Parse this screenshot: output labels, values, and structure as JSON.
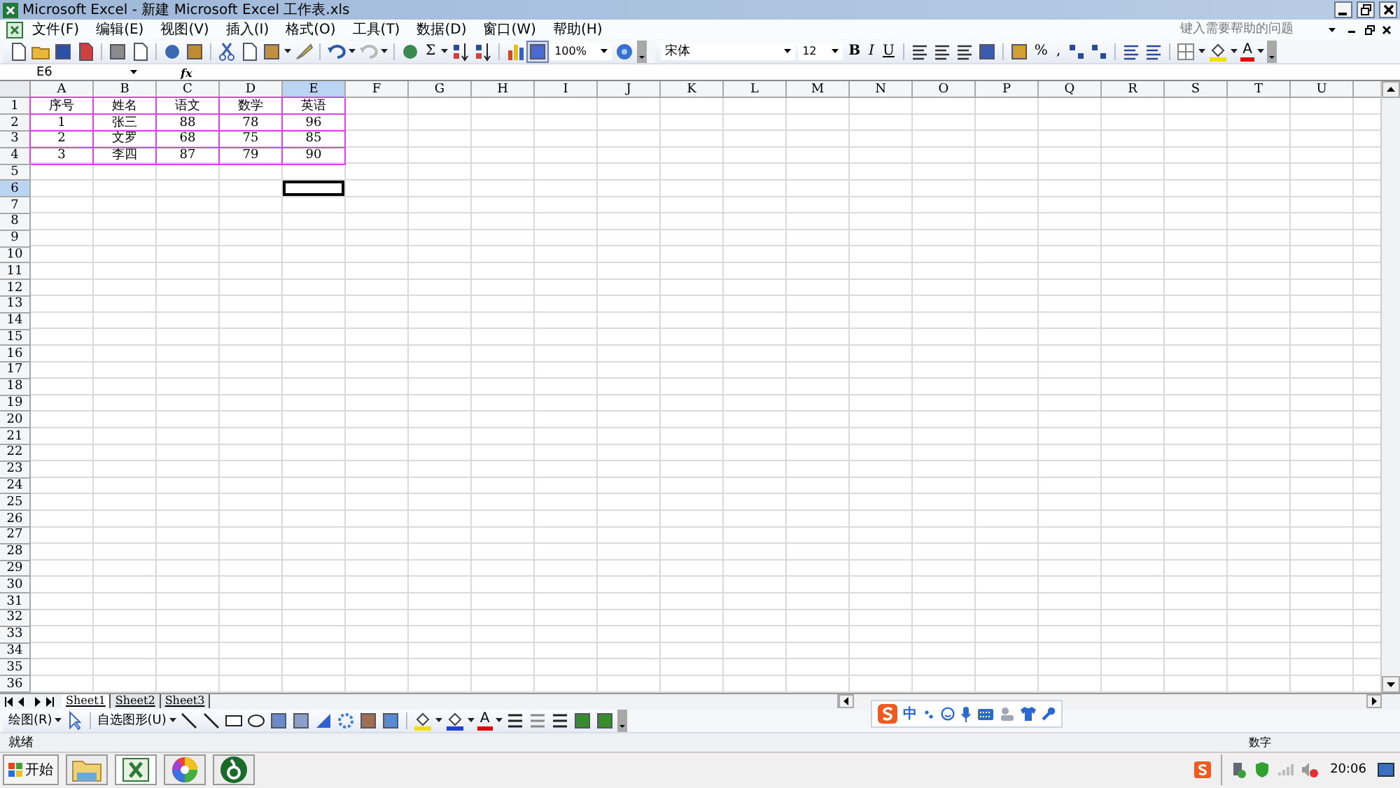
{
  "window": {
    "title": "Microsoft Excel - 新建 Microsoft Excel 工作表.xls"
  },
  "menu": [
    "文件(F)",
    "编辑(E)",
    "视图(V)",
    "插入(I)",
    "格式(O)",
    "工具(T)",
    "数据(D)",
    "窗口(W)",
    "帮助(H)"
  ],
  "help_search": {
    "placeholder": "键入需要帮助的问题"
  },
  "standard_toolbar": {
    "autosum": "Σ",
    "zoom": "100%"
  },
  "formatting_toolbar": {
    "font": "宋体",
    "size": "12",
    "bold": "B",
    "italic": "I",
    "underline": "U",
    "percent": "%",
    "comma": ",",
    "font_color": "A"
  },
  "formula_bar": {
    "name_box": "E6",
    "fx": "fx"
  },
  "sheet": {
    "columns": [
      {
        "label": "A",
        "selected": false
      },
      {
        "label": "B",
        "selected": false
      },
      {
        "label": "C",
        "selected": false
      },
      {
        "label": "D",
        "selected": false
      },
      {
        "label": "E",
        "selected": true
      },
      {
        "label": "F",
        "selected": false
      },
      {
        "label": "G",
        "selected": false
      },
      {
        "label": "H",
        "selected": false
      },
      {
        "label": "I",
        "selected": false
      },
      {
        "label": "J",
        "selected": false
      },
      {
        "label": "K",
        "selected": false
      },
      {
        "label": "L",
        "selected": false
      },
      {
        "label": "M",
        "selected": false
      },
      {
        "label": "N",
        "selected": false
      },
      {
        "label": "O",
        "selected": false
      },
      {
        "label": "P",
        "selected": false
      },
      {
        "label": "Q",
        "selected": false
      },
      {
        "label": "R",
        "selected": false
      },
      {
        "label": "S",
        "selected": false
      },
      {
        "label": "T",
        "selected": false
      },
      {
        "label": "U",
        "selected": false
      }
    ],
    "rows": [
      {
        "label": "1",
        "selected": false,
        "cells": [
          "序号",
          "姓名",
          "语文",
          "数学",
          "英语"
        ]
      },
      {
        "label": "2",
        "selected": false,
        "cells": [
          "1",
          "张三",
          "88",
          "78",
          "96"
        ]
      },
      {
        "label": "3",
        "selected": false,
        "cells": [
          "2",
          "文罗",
          "68",
          "75",
          "85"
        ]
      },
      {
        "label": "4",
        "selected": false,
        "cells": [
          "3",
          "李四",
          "87",
          "79",
          "90"
        ]
      },
      {
        "label": "5",
        "selected": false
      },
      {
        "label": "6",
        "selected": true
      },
      {
        "label": "7",
        "selected": false
      },
      {
        "label": "8",
        "selected": false
      },
      {
        "label": "9",
        "selected": false
      },
      {
        "label": "10",
        "selected": false
      },
      {
        "label": "11",
        "selected": false
      },
      {
        "label": "12",
        "selected": false
      },
      {
        "label": "13",
        "selected": false
      },
      {
        "label": "14",
        "selected": false
      },
      {
        "label": "15",
        "selected": false
      },
      {
        "label": "16",
        "selected": false
      },
      {
        "label": "17",
        "selected": false
      },
      {
        "label": "18",
        "selected": false
      },
      {
        "label": "19",
        "selected": false
      },
      {
        "label": "20",
        "selected": false
      },
      {
        "label": "21",
        "selected": false
      },
      {
        "label": "22",
        "selected": false
      },
      {
        "label": "23",
        "selected": false
      },
      {
        "label": "24",
        "selected": false
      },
      {
        "label": "25",
        "selected": false
      },
      {
        "label": "26",
        "selected": false
      },
      {
        "label": "27",
        "selected": false
      },
      {
        "label": "28",
        "selected": false
      },
      {
        "label": "29",
        "selected": false
      },
      {
        "label": "30",
        "selected": false
      },
      {
        "label": "31",
        "selected": false
      },
      {
        "label": "32",
        "selected": false
      },
      {
        "label": "33",
        "selected": false
      },
      {
        "label": "34",
        "selected": false
      },
      {
        "label": "35",
        "selected": false
      },
      {
        "label": "36",
        "selected": false
      }
    ]
  },
  "sheet_tabs": [
    {
      "label": "Sheet1",
      "selected": true
    },
    {
      "label": "Sheet2",
      "selected": false
    },
    {
      "label": "Sheet3",
      "selected": false
    }
  ],
  "drawing_toolbar": {
    "draw_menu": "绘图(R)",
    "autoshapes_menu": "自选图形(U)",
    "font_color": "A"
  },
  "ime_bar": {
    "mode": "中"
  },
  "status_bar": {
    "status": "就绪",
    "mode": "数字"
  },
  "taskbar": {
    "start": "开始",
    "clock": "20:06"
  }
}
